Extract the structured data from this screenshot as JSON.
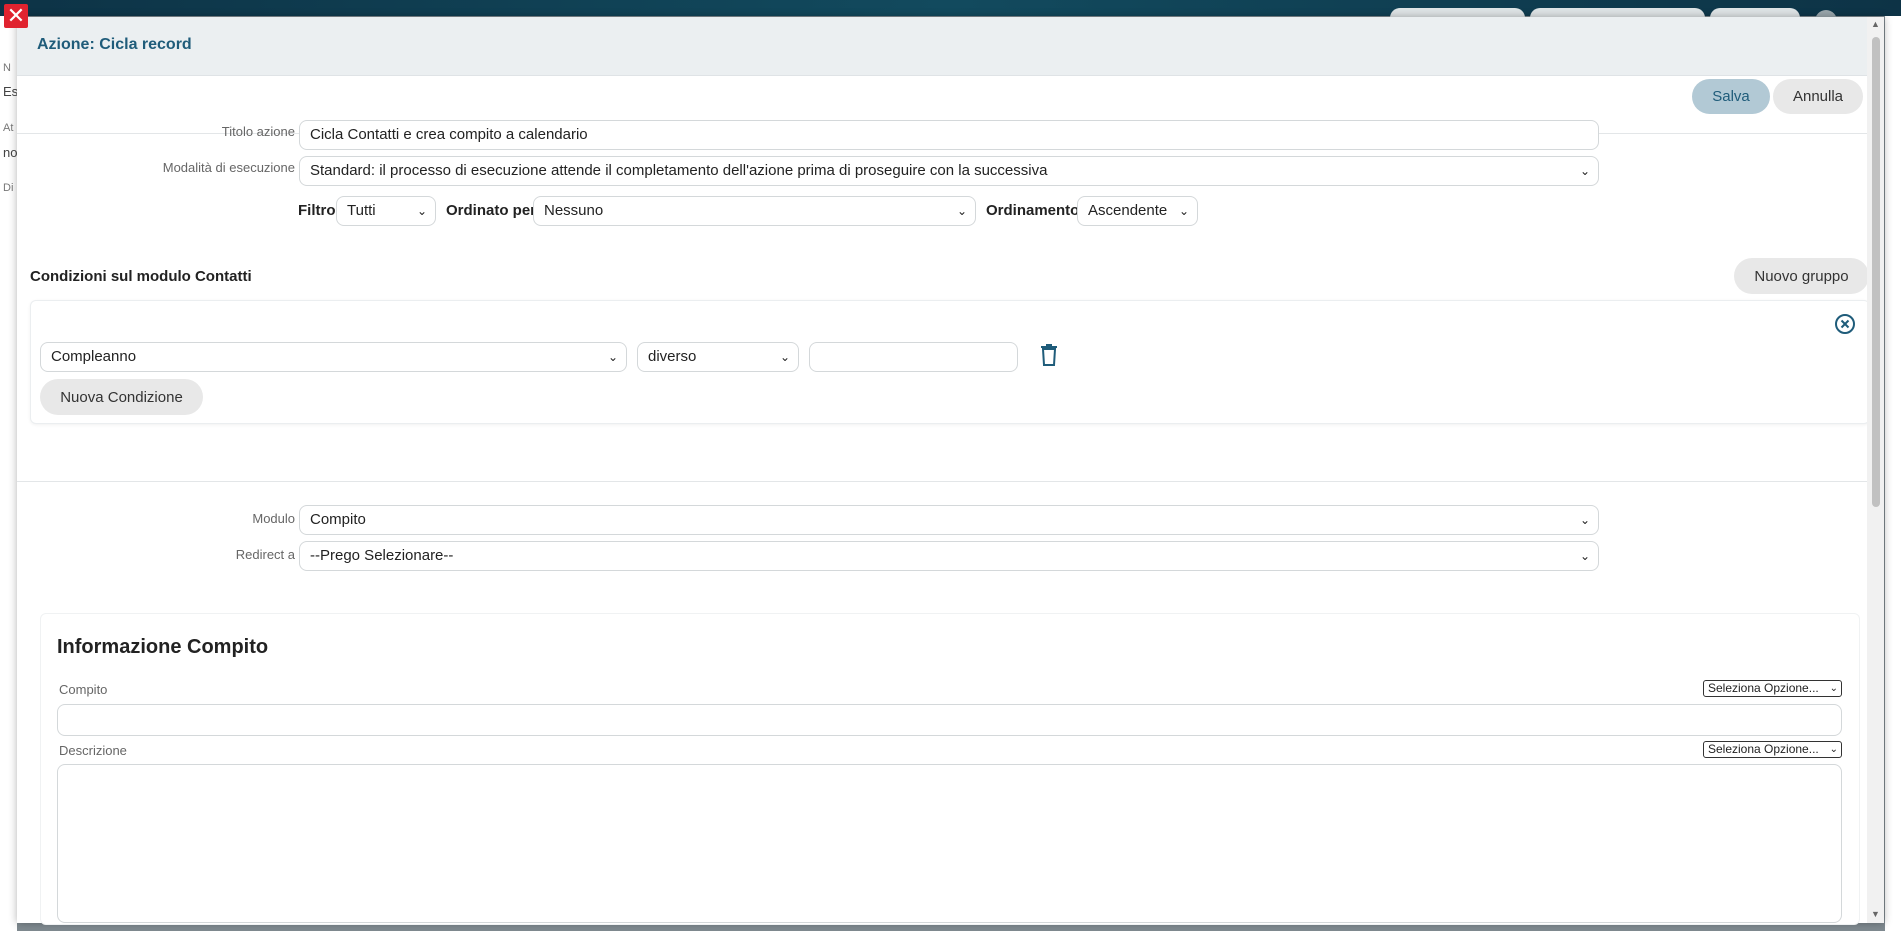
{
  "background": {
    "sidebar_fragments": [
      "N",
      "Es",
      "At",
      "no",
      "Di"
    ]
  },
  "modal": {
    "title": "Azione: Cicla record",
    "buttons": {
      "save": "Salva",
      "cancel": "Annulla"
    },
    "fields": {
      "titolo_label": "Titolo azione",
      "titolo_value": "Cicla Contatti e crea compito a calendario",
      "modalita_label": "Modalità di esecuzione",
      "modalita_value": "Standard: il processo di esecuzione attende il completamento dell'azione prima di proseguire con la successiva"
    },
    "filter_row": {
      "filtro_label": "Filtro",
      "filtro_value": "Tutti",
      "ordinato_label": "Ordinato per",
      "ordinato_value": "Nessuno",
      "ordinamento_label": "Ordinamento",
      "ordinamento_value": "Ascendente"
    },
    "conditions": {
      "title": "Condizioni sul modulo Contatti",
      "new_group_button": "Nuovo gruppo",
      "field_value": "Compleanno",
      "operator_value": "diverso",
      "compare_value": "",
      "new_condition_button": "Nuova Condizione"
    },
    "module": {
      "modulo_label": "Modulo",
      "modulo_value": "Compito",
      "redirect_label": "Redirect a",
      "redirect_value": "--Prego Selezionare--"
    },
    "info": {
      "title": "Informazione Compito",
      "compito_label": "Compito",
      "compito_value": "",
      "compito_option": "Seleziona Opzione...",
      "descrizione_label": "Descrizione",
      "descrizione_value": "",
      "descrizione_option": "Seleziona Opzione..."
    }
  },
  "colors": {
    "accent": "#1f5c7a",
    "close_red": "#e0232f",
    "save_button_bg": "#b2c9d5",
    "header_bg": "#ebeff1"
  },
  "icons": {
    "close": "close-icon",
    "trash": "trash-icon",
    "remove_group": "circle-x-icon",
    "dropdown": "chevron-down-icon"
  }
}
